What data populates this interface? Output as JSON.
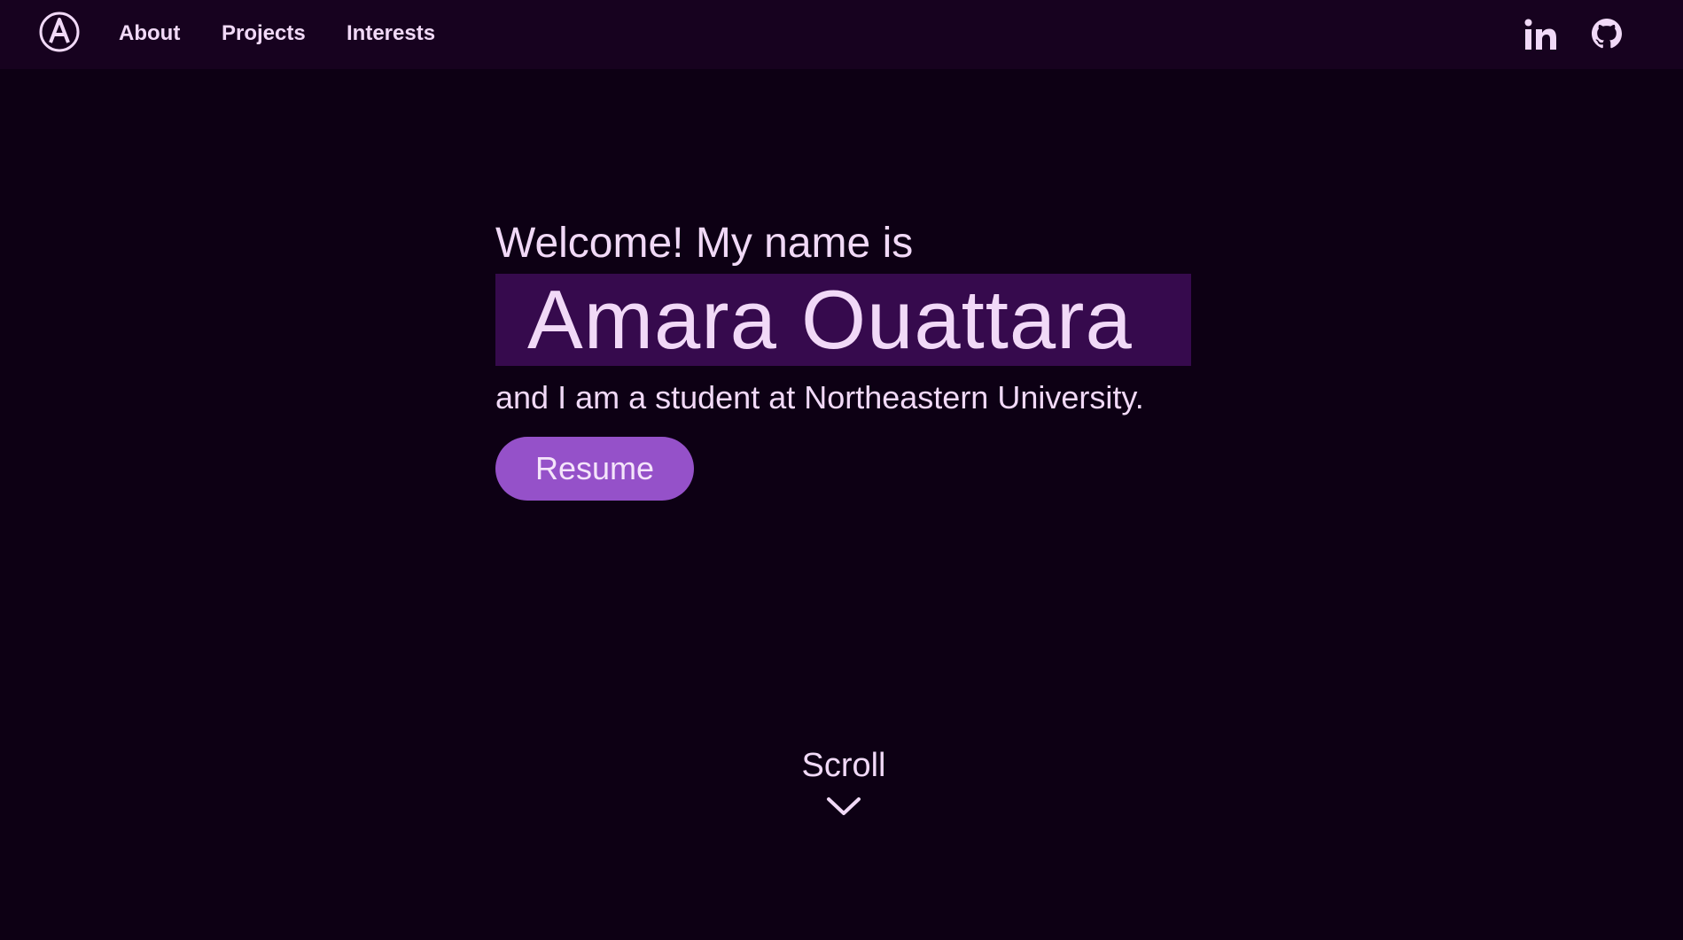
{
  "nav": {
    "logo_icon": "a-monogram-logo-icon",
    "links": [
      {
        "label": "About"
      },
      {
        "label": "Projects"
      },
      {
        "label": "Interests"
      }
    ],
    "social": [
      {
        "icon": "linkedin-icon"
      },
      {
        "icon": "github-icon"
      }
    ]
  },
  "hero": {
    "greeting": "Welcome! My name is",
    "name": "Amara Ouattara",
    "tagline": "and I am a student at Northeastern University.",
    "resume_label": "Resume"
  },
  "scroll": {
    "label": "Scroll",
    "icon": "chevron-down-icon"
  },
  "colors": {
    "background": "#0d0014",
    "navbar": "#17021f",
    "text": "#f1d9f7",
    "name_highlight": "#360a4d",
    "accent_button": "#9551c9"
  }
}
